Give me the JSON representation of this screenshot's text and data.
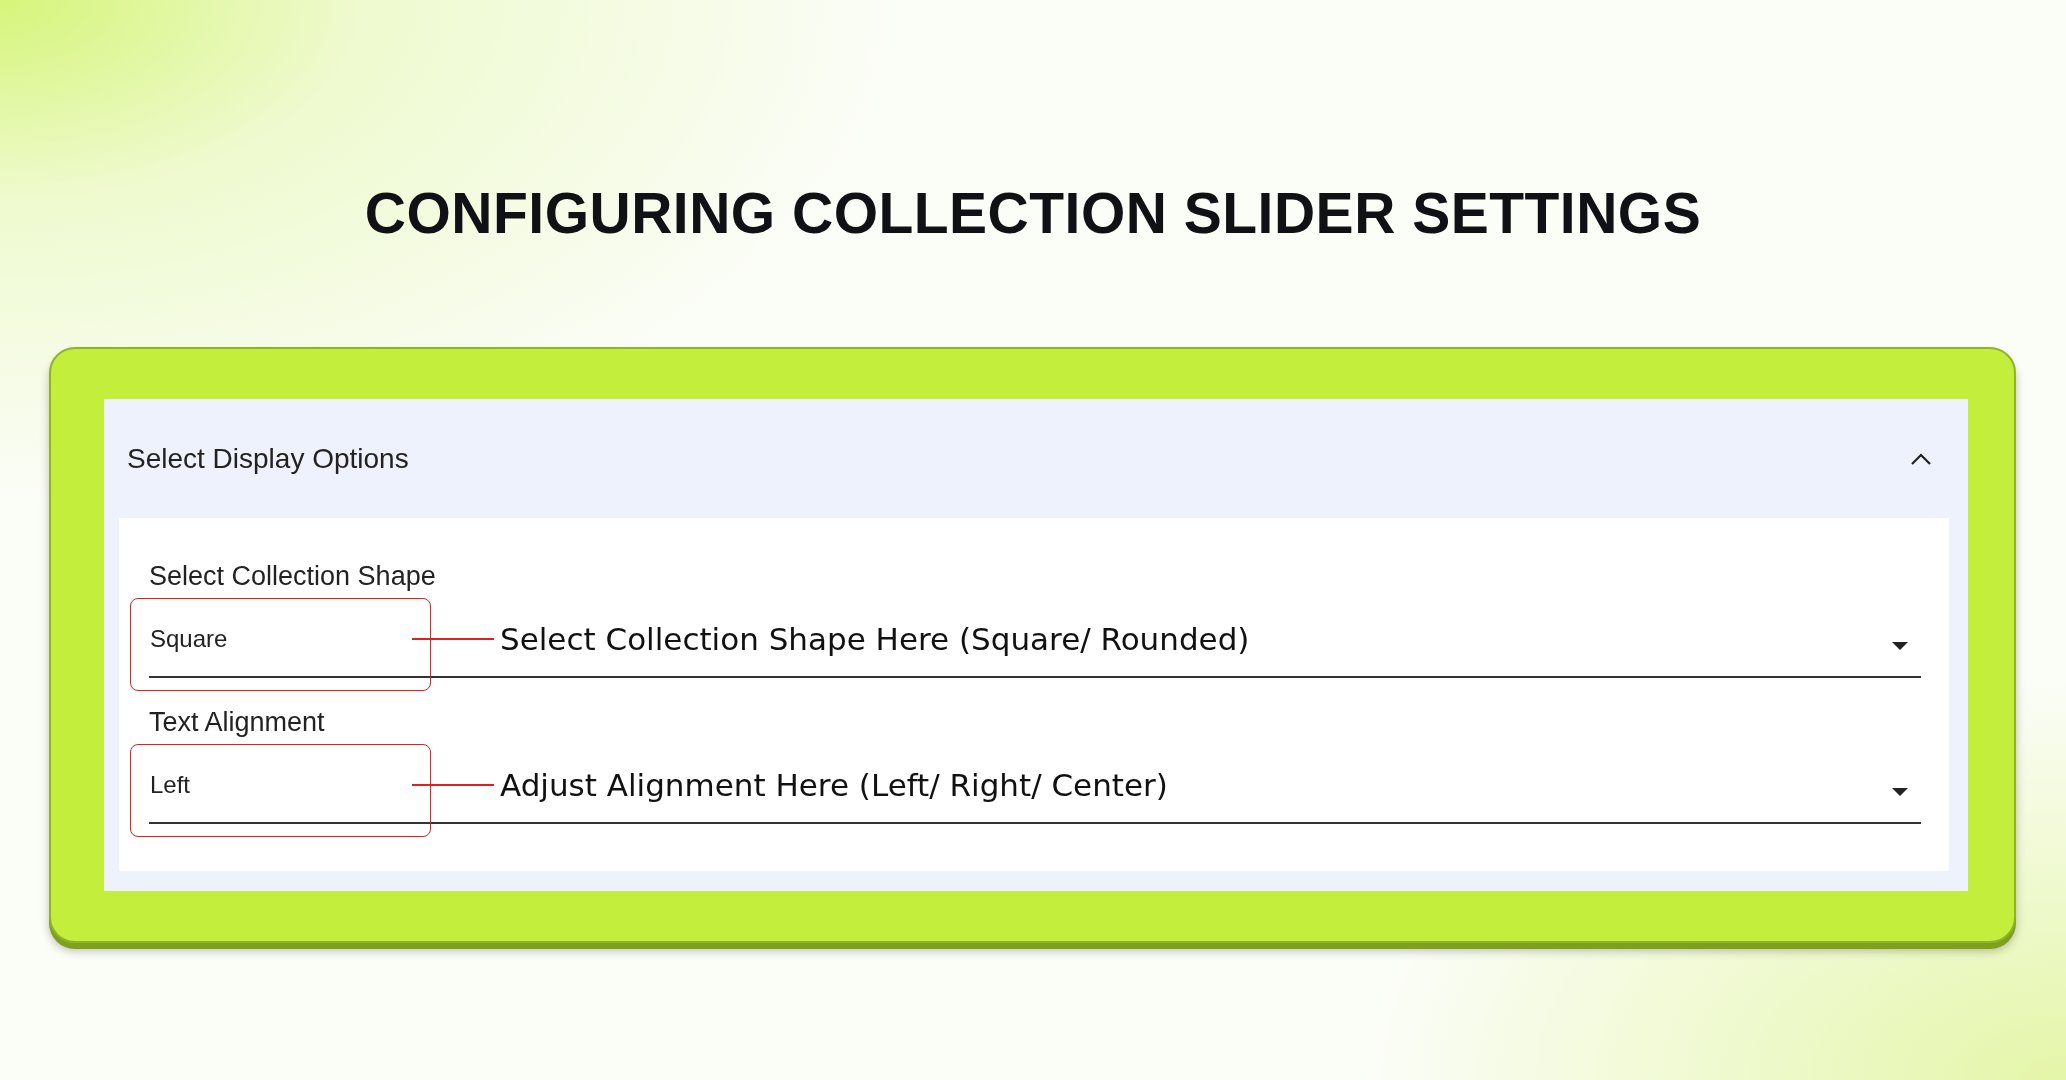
{
  "title": "CONFIGURING COLLECTION SLIDER SETTINGS",
  "panel": {
    "title": "Select Display Options",
    "expanded": true,
    "fields": [
      {
        "label": "Select Collection Shape",
        "value": "Square",
        "annotation": "Select Collection Shape Here (Square/ Rounded)"
      },
      {
        "label": "Text Alignment",
        "value": "Left",
        "annotation": "Adjust Alignment Here (Left/ Right/ Center)"
      }
    ]
  }
}
